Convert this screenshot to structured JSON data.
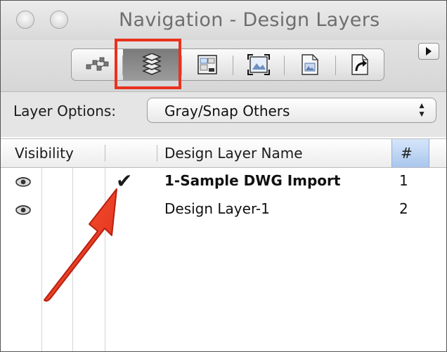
{
  "window": {
    "title": "Navigation - Design Layers"
  },
  "toolbar": {
    "tabs": [
      {
        "icon": "network-graph-icon",
        "selected": false
      },
      {
        "icon": "layers-icon",
        "selected": true
      },
      {
        "icon": "sheet-layer-icon",
        "selected": false
      },
      {
        "icon": "viewport-icon",
        "selected": false
      },
      {
        "icon": "document-icon",
        "selected": false
      },
      {
        "icon": "reference-icon",
        "selected": false
      }
    ],
    "side_button_icon": "triangle-right-icon"
  },
  "layer_options": {
    "label": "Layer Options:",
    "selected": "Gray/Snap Others"
  },
  "table": {
    "headers": {
      "visibility": "Visibility",
      "name": "Design Layer Name",
      "number": "#"
    },
    "rows": [
      {
        "visible_icon": "eye-icon",
        "active": true,
        "name": "1-Sample DWG Import",
        "number": "1",
        "bold": true
      },
      {
        "visible_icon": "eye-icon",
        "active": false,
        "name": "Design Layer-1",
        "number": "2",
        "bold": false
      }
    ]
  },
  "annotations": {
    "highlight_color": "#e8321e",
    "arrow_color": "#e8321e"
  }
}
